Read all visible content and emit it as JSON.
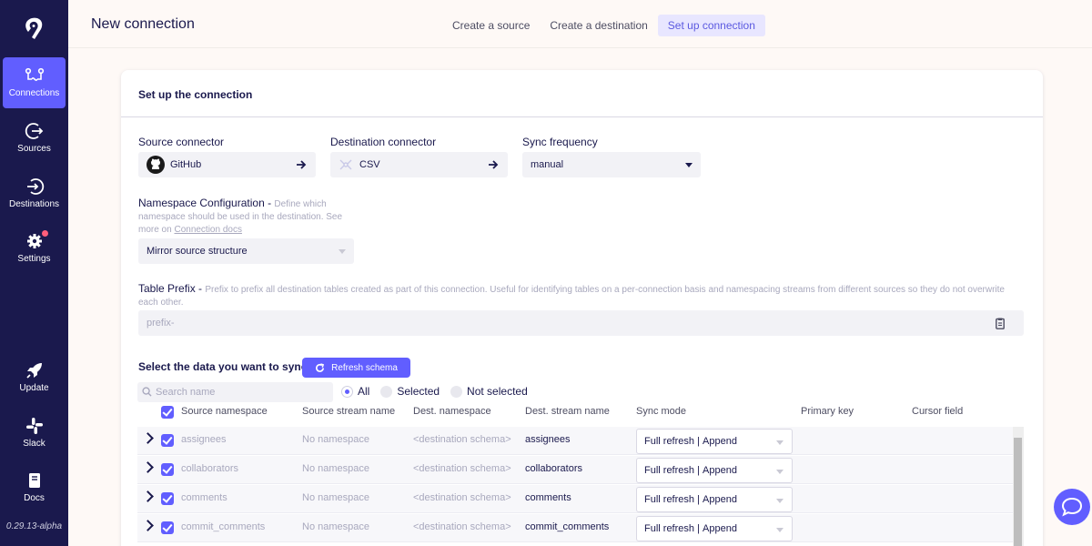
{
  "sidebar": {
    "items": [
      {
        "label": "Connections",
        "icon": "connections-icon"
      },
      {
        "label": "Sources",
        "icon": "sources-icon"
      },
      {
        "label": "Destinations",
        "icon": "destinations-icon"
      },
      {
        "label": "Settings",
        "icon": "gear-icon"
      },
      {
        "label": "Update",
        "icon": "rocket-icon"
      },
      {
        "label": "Slack",
        "icon": "slack-icon"
      },
      {
        "label": "Docs",
        "icon": "book-icon"
      }
    ],
    "version": "0.29.13-alpha"
  },
  "header": {
    "title": "New connection",
    "steps": [
      "Create a source",
      "Create a destination",
      "Set up connection"
    ]
  },
  "card": {
    "title": "Set up the connection",
    "source": {
      "label": "Source connector",
      "value": "GitHub"
    },
    "destination": {
      "label": "Destination connector",
      "value": "CSV"
    },
    "frequency": {
      "label": "Sync frequency",
      "value": "manual"
    },
    "namespace": {
      "label": "Namespace Configuration - ",
      "hint_a": "Define which namespace should be used in the destination. See more on ",
      "hint_link": "Connection docs",
      "value": "Mirror source structure"
    },
    "prefix": {
      "label": "Table Prefix - ",
      "hint": "Prefix to prefix all destination tables created as part of this connection. Useful for identifying tables on a per-connection basis and namespacing streams from different sources so they do not overwrite each other.",
      "placeholder": "prefix-"
    },
    "sync": {
      "title": "Select the data you want to sync",
      "refresh": "Refresh schema",
      "search_placeholder": "Search name",
      "filters": [
        "All",
        "Selected",
        "Not selected"
      ]
    },
    "columns": [
      "Source namespace",
      "Source stream name",
      "Dest. namespace",
      "Dest. stream name",
      "Sync mode",
      "Primary key",
      "Cursor field"
    ],
    "rows": [
      {
        "name": "assignees",
        "src_ns": "No namespace",
        "dest_ns": "<destination schema>",
        "dest_name": "assignees",
        "mode_a": "Full refresh",
        "sep": "|",
        "mode_b": "Append"
      },
      {
        "name": "collaborators",
        "src_ns": "No namespace",
        "dest_ns": "<destination schema>",
        "dest_name": "collaborators",
        "mode_a": "Full refresh",
        "sep": "|",
        "mode_b": "Append"
      },
      {
        "name": "comments",
        "src_ns": "No namespace",
        "dest_ns": "<destination schema>",
        "dest_name": "comments",
        "mode_a": "Full refresh",
        "sep": "|",
        "mode_b": "Append"
      },
      {
        "name": "commit_comments",
        "src_ns": "No namespace",
        "dest_ns": "<destination schema>",
        "dest_name": "commit_comments",
        "mode_a": "Full refresh",
        "sep": "|",
        "mode_b": "Append"
      }
    ]
  },
  "colors": {
    "accent": "#615eff",
    "sidebar": "#1a194d",
    "background": "#fef9f6"
  }
}
